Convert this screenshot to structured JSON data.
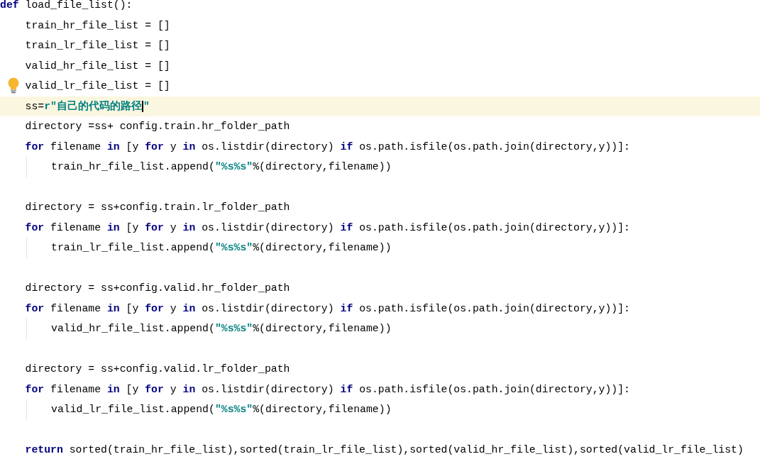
{
  "code": {
    "lines": [
      {
        "kind": "code",
        "tokens": [
          {
            "kind": "keyword",
            "text": "def"
          },
          {
            "kind": "plain",
            "text": " load_file_list():"
          }
        ],
        "children": [
          {
            "kind": "code",
            "tokens": [
              {
                "kind": "plain",
                "text": "train_hr_file_list = []"
              }
            ]
          },
          {
            "kind": "code",
            "tokens": [
              {
                "kind": "plain",
                "text": "train_lr_file_list = []"
              }
            ]
          },
          {
            "kind": "code",
            "tokens": [
              {
                "kind": "plain",
                "text": "valid_hr_file_list = []"
              }
            ]
          },
          {
            "kind": "code",
            "hint_icon": true,
            "tokens": [
              {
                "kind": "plain",
                "text": "valid_lr_file_list = []"
              }
            ]
          },
          {
            "kind": "code",
            "current": true,
            "tokens": [
              {
                "kind": "plain",
                "text": "ss="
              },
              {
                "kind": "string",
                "text": "r″自己的代码的路径",
                "caret": true
              },
              {
                "kind": "string",
                "text": "″"
              }
            ]
          },
          {
            "kind": "code",
            "tokens": [
              {
                "kind": "plain",
                "text": "directory =ss+ config.train.hr_folder_path"
              }
            ]
          },
          {
            "kind": "code",
            "tokens": [
              {
                "kind": "keyword",
                "text": "for"
              },
              {
                "kind": "plain",
                "text": " filename "
              },
              {
                "kind": "keyword",
                "text": "in"
              },
              {
                "kind": "plain",
                "text": " [y "
              },
              {
                "kind": "keyword",
                "text": "for"
              },
              {
                "kind": "plain",
                "text": " y "
              },
              {
                "kind": "keyword",
                "text": "in"
              },
              {
                "kind": "plain",
                "text": " os.listdir(directory) "
              },
              {
                "kind": "keyword",
                "text": "if"
              },
              {
                "kind": "plain",
                "text": " os.path.isfile(os.path.join(directory,y))]:"
              }
            ],
            "children": [
              {
                "kind": "code",
                "tokens": [
                  {
                    "kind": "plain",
                    "text": "train_hr_file_list.append("
                  },
                  {
                    "kind": "string",
                    "text": "″%s%s″"
                  },
                  {
                    "kind": "plain",
                    "text": "%(directory,filename))"
                  }
                ]
              }
            ]
          },
          {
            "kind": "blank"
          },
          {
            "kind": "code",
            "tokens": [
              {
                "kind": "plain",
                "text": "directory = ss+config.train.lr_folder_path"
              }
            ]
          },
          {
            "kind": "code",
            "tokens": [
              {
                "kind": "keyword",
                "text": "for"
              },
              {
                "kind": "plain",
                "text": " filename "
              },
              {
                "kind": "keyword",
                "text": "in"
              },
              {
                "kind": "plain",
                "text": " [y "
              },
              {
                "kind": "keyword",
                "text": "for"
              },
              {
                "kind": "plain",
                "text": " y "
              },
              {
                "kind": "keyword",
                "text": "in"
              },
              {
                "kind": "plain",
                "text": " os.listdir(directory) "
              },
              {
                "kind": "keyword",
                "text": "if"
              },
              {
                "kind": "plain",
                "text": " os.path.isfile(os.path.join(directory,y))]:"
              }
            ],
            "children": [
              {
                "kind": "code",
                "tokens": [
                  {
                    "kind": "plain",
                    "text": "train_lr_file_list.append("
                  },
                  {
                    "kind": "string",
                    "text": "″%s%s″"
                  },
                  {
                    "kind": "plain",
                    "text": "%(directory,filename))"
                  }
                ]
              }
            ]
          },
          {
            "kind": "blank"
          },
          {
            "kind": "code",
            "tokens": [
              {
                "kind": "plain",
                "text": "directory = ss+config.valid.hr_folder_path"
              }
            ]
          },
          {
            "kind": "code",
            "tokens": [
              {
                "kind": "keyword",
                "text": "for"
              },
              {
                "kind": "plain",
                "text": " filename "
              },
              {
                "kind": "keyword",
                "text": "in"
              },
              {
                "kind": "plain",
                "text": " [y "
              },
              {
                "kind": "keyword",
                "text": "for"
              },
              {
                "kind": "plain",
                "text": " y "
              },
              {
                "kind": "keyword",
                "text": "in"
              },
              {
                "kind": "plain",
                "text": " os.listdir(directory) "
              },
              {
                "kind": "keyword",
                "text": "if"
              },
              {
                "kind": "plain",
                "text": " os.path.isfile(os.path.join(directory,y))]:"
              }
            ],
            "children": [
              {
                "kind": "code",
                "tokens": [
                  {
                    "kind": "plain",
                    "text": "valid_hr_file_list.append("
                  },
                  {
                    "kind": "string",
                    "text": "″%s%s″"
                  },
                  {
                    "kind": "plain",
                    "text": "%(directory,filename))"
                  }
                ]
              }
            ]
          },
          {
            "kind": "blank"
          },
          {
            "kind": "code",
            "tokens": [
              {
                "kind": "plain",
                "text": "directory = ss+config.valid.lr_folder_path"
              }
            ]
          },
          {
            "kind": "code",
            "tokens": [
              {
                "kind": "keyword",
                "text": "for"
              },
              {
                "kind": "plain",
                "text": " filename "
              },
              {
                "kind": "keyword",
                "text": "in"
              },
              {
                "kind": "plain",
                "text": " [y "
              },
              {
                "kind": "keyword",
                "text": "for"
              },
              {
                "kind": "plain",
                "text": " y "
              },
              {
                "kind": "keyword",
                "text": "in"
              },
              {
                "kind": "plain",
                "text": " os.listdir(directory) "
              },
              {
                "kind": "keyword",
                "text": "if"
              },
              {
                "kind": "plain",
                "text": " os.path.isfile(os.path.join(directory,y))]:"
              }
            ],
            "children": [
              {
                "kind": "code",
                "tokens": [
                  {
                    "kind": "plain",
                    "text": "valid_lr_file_list.append("
                  },
                  {
                    "kind": "string",
                    "text": "″%s%s″"
                  },
                  {
                    "kind": "plain",
                    "text": "%(directory,filename))"
                  }
                ]
              }
            ]
          },
          {
            "kind": "blank"
          },
          {
            "kind": "code",
            "tokens": [
              {
                "kind": "keyword",
                "text": "return"
              },
              {
                "kind": "plain",
                "text": " sorted(train_hr_file_list),sorted(train_lr_file_list),sorted(valid_hr_file_list),sorted(valid_lr_file_list)"
              }
            ]
          }
        ]
      }
    ]
  }
}
